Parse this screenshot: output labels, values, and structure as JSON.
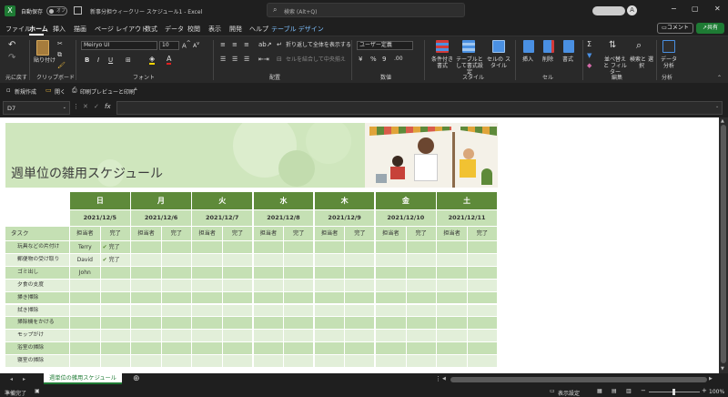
{
  "titlebar": {
    "autosave_label": "自動保存",
    "autosave_state": "オフ",
    "doc_title": "新事分担ウィークリー スケジュール1 - Excel",
    "search_placeholder": "検索 (Alt+Q)",
    "user_initial": "A"
  },
  "ribbon_tabs": [
    "ファイル",
    "ホーム",
    "挿入",
    "描画",
    "ページ レイアウト",
    "数式",
    "データ",
    "校閲",
    "表示",
    "開発",
    "ヘルプ",
    "テーブル デザイン"
  ],
  "ribbon_tab_active": "ホーム",
  "comment_btn": "コメント",
  "share_btn": "共有",
  "ribbon": {
    "undo_label": "元に戻す",
    "paste_label": "貼り付け",
    "font_name": "Meiryo UI",
    "font_size": "10",
    "wrap_label": "折り返して全体を表示する",
    "merge_label": "セルを結合して中央揃え",
    "number_format": "ユーザー定義",
    "cond_format": "条件付き書式",
    "table_format": "テーブルとして書式設定",
    "cell_styles": "セルの スタイル",
    "insert": "挿入",
    "delete": "削除",
    "format": "書式",
    "sort_filter": "並べ替えと フィルター",
    "find_select": "検索と 選択",
    "analyze": "データ 分析",
    "groups": [
      "元に戻す",
      "クリップボード",
      "フォント",
      "配置",
      "数値",
      "スタイル",
      "セル",
      "編集",
      "分析"
    ]
  },
  "qat": {
    "new": "新規作成",
    "open": "開く",
    "print_preview": "印刷プレビューと印刷"
  },
  "formula_bar": {
    "name_box": "D7",
    "fx": "fx",
    "formula": ""
  },
  "schedule": {
    "title": "週単位の雑用スケジュール",
    "days": [
      "日",
      "月",
      "火",
      "水",
      "木",
      "金",
      "土"
    ],
    "dates": [
      "2021/12/5",
      "2021/12/6",
      "2021/12/7",
      "2021/12/8",
      "2021/12/9",
      "2021/12/10",
      "2021/12/11"
    ],
    "task_header": "タスク",
    "assignee_header": "担当者",
    "done_header": "完了",
    "tasks": [
      {
        "name": "玩具などの片付け",
        "assignee": "Terry",
        "done": "完了"
      },
      {
        "name": "郵便物の受け取り",
        "assignee": "David",
        "done": "完了"
      },
      {
        "name": "ゴミ出し",
        "assignee": "John",
        "done": ""
      },
      {
        "name": "夕食の支度",
        "assignee": "",
        "done": ""
      },
      {
        "name": "掃き掃除",
        "assignee": "",
        "done": ""
      },
      {
        "name": "拭き掃除",
        "assignee": "",
        "done": ""
      },
      {
        "name": "掃除機をかける",
        "assignee": "",
        "done": ""
      },
      {
        "name": "モップがけ",
        "assignee": "",
        "done": ""
      },
      {
        "name": "浴室の掃除",
        "assignee": "",
        "done": ""
      },
      {
        "name": "寝室の掃除",
        "assignee": "",
        "done": ""
      }
    ]
  },
  "sheet_tab": "週単位の雑用スケジュール",
  "status": {
    "ready": "準備完了",
    "display_settings": "表示設定",
    "zoom": "100%"
  },
  "colors": {
    "dark_green": "#5e8a3a",
    "mid_green": "#c5e0b4",
    "light_green": "#e2efd9",
    "title_band": "#c9e3b5",
    "accent_blue": "#2b7fd6",
    "green_share": "#1e7b34"
  }
}
